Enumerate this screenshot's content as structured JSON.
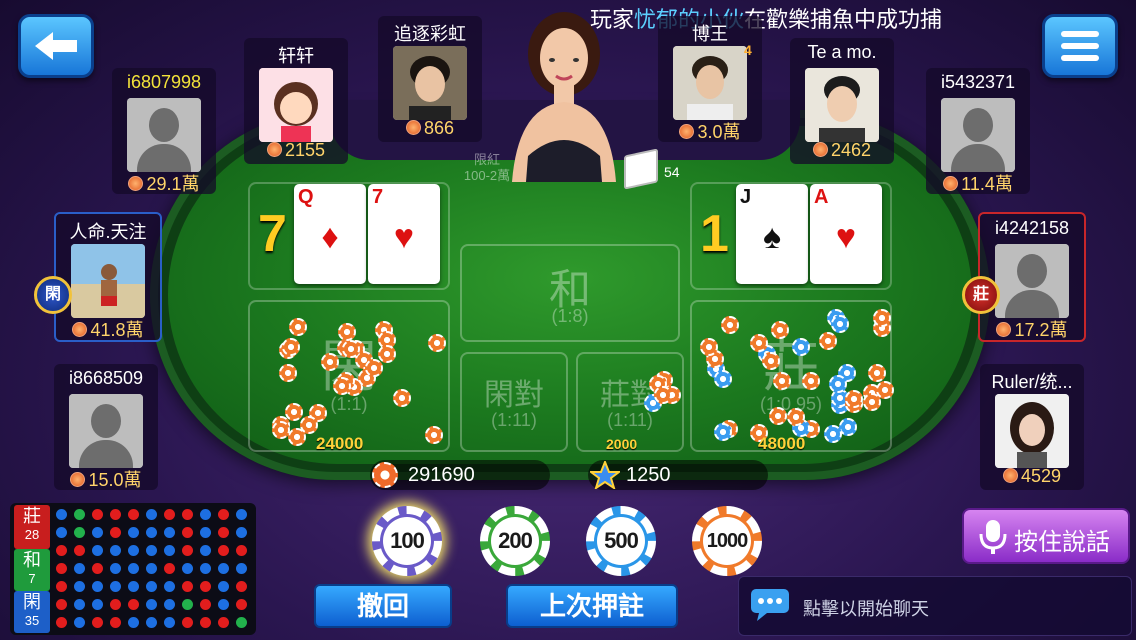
{
  "notice": {
    "prefix": "玩家",
    "player": "忧郁的小伙",
    "suffix": "在歡樂捕魚中成功捕"
  },
  "table": {
    "limit_label": "限紅",
    "limit_range": "100-2萬",
    "deck_count": "54"
  },
  "players": {
    "p1": {
      "name": "i6807998",
      "money": "29.1萬"
    },
    "p2": {
      "name": "轩轩",
      "money": "2155"
    },
    "p3": {
      "name": "追逐彩虹",
      "money": "866"
    },
    "p4": {
      "name": "博王",
      "money": "3.0萬",
      "level": "4"
    },
    "p5": {
      "name": "Te a mo.",
      "money": "2462"
    },
    "p6": {
      "name": "i5432371",
      "money": "11.4萬"
    },
    "p7": {
      "name": "人命.天注",
      "money": "41.8萬",
      "badge": "閑"
    },
    "p8": {
      "name": "i4242158",
      "money": "17.2萬",
      "badge": "莊"
    },
    "p9": {
      "name": "i8668509",
      "money": "15.0萬"
    },
    "p10": {
      "name": "Ruler/统...",
      "money": "4529"
    }
  },
  "player_hand": {
    "score": "7",
    "cards": [
      {
        "rank": "Q",
        "suit": "♦"
      },
      {
        "rank": "7",
        "suit": "♥"
      }
    ]
  },
  "banker_hand": {
    "score": "1",
    "cards": [
      {
        "rank": "J",
        "suit": "♠"
      },
      {
        "rank": "A",
        "suit": "♥"
      }
    ]
  },
  "bets": {
    "tie": {
      "label": "和",
      "odds": "(1:8)"
    },
    "player": {
      "label": "閑",
      "odds": "(1:1)",
      "amount": "24000"
    },
    "player_pair": {
      "label": "閑對",
      "odds": "(1:11)"
    },
    "banker_pair": {
      "label": "莊對",
      "odds": "(1:11)",
      "amount": "2000"
    },
    "banker": {
      "label": "莊",
      "odds": "(1:0.95)",
      "amount": "48000"
    }
  },
  "balance": {
    "coins": "291690",
    "stars": "1250"
  },
  "chips": [
    "100",
    "200",
    "500",
    "1000"
  ],
  "actions": {
    "undo": "撤回",
    "repeat": "上次押註",
    "voice": "按住說話",
    "chat_placeholder": "點擊以開始聊天"
  },
  "road": {
    "banker": {
      "label": "莊",
      "count": "28"
    },
    "tie": {
      "label": "和",
      "count": "7"
    },
    "player": {
      "label": "閑",
      "count": "35"
    }
  },
  "colors": {
    "banker": "#e21d1d",
    "player": "#1d6fe2",
    "tie": "#22b14c",
    "gold": "#ffcc22"
  }
}
